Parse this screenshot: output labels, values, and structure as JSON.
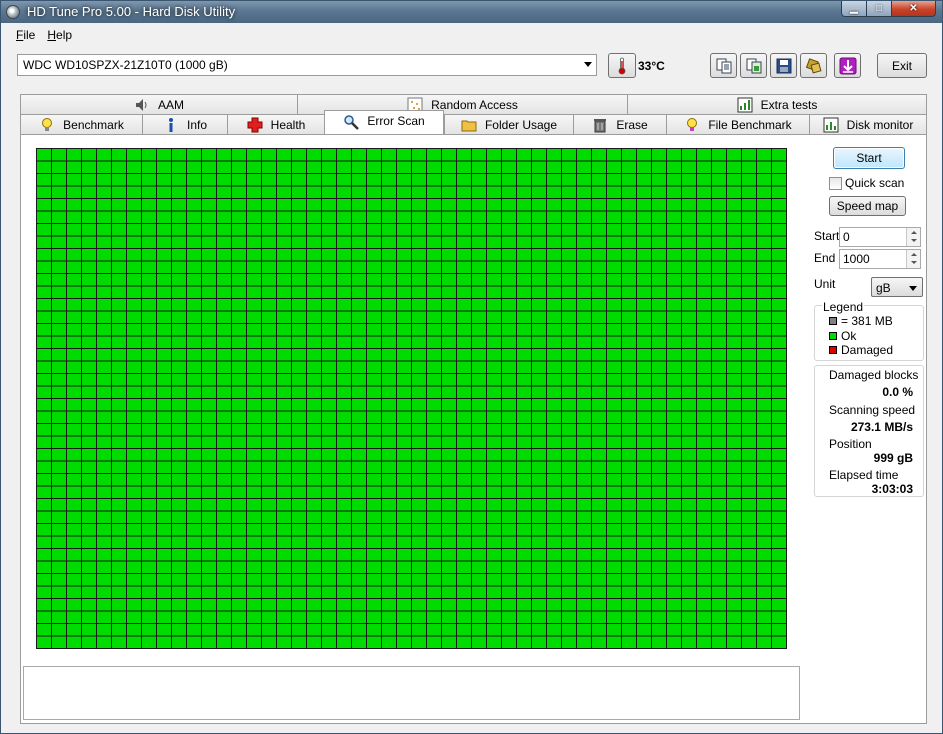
{
  "window": {
    "title": "HD Tune Pro 5.00 - Hard Disk Utility"
  },
  "menu": {
    "file": "File",
    "help": "Help"
  },
  "toolbar": {
    "drive": "WDC WD10SPZX-21Z10T0 (1000 gB)",
    "temperature": "33°C",
    "exit_label": "Exit",
    "icons": [
      "copy-text-icon",
      "copy-screenshot-icon",
      "save-icon",
      "options-icon",
      "download-icon"
    ]
  },
  "tabs_top": [
    {
      "label": "AAM",
      "icon": "speaker-icon"
    },
    {
      "label": "Random Access",
      "icon": "random-access-icon"
    },
    {
      "label": "Extra tests",
      "icon": "extra-tests-icon"
    }
  ],
  "tabs_bottom": [
    {
      "label": "Benchmark",
      "icon": "lightbulb-icon"
    },
    {
      "label": "Info",
      "icon": "info-icon"
    },
    {
      "label": "Health",
      "icon": "health-cross-icon"
    },
    {
      "label": "Error Scan",
      "icon": "magnifier-icon",
      "active": true
    },
    {
      "label": "Folder Usage",
      "icon": "folder-icon"
    },
    {
      "label": "Erase",
      "icon": "trash-icon"
    },
    {
      "label": "File Benchmark",
      "icon": "file-benchmark-icon"
    },
    {
      "label": "Disk monitor",
      "icon": "disk-monitor-icon"
    }
  ],
  "scan": {
    "start_label": "Start",
    "quick_scan_label": "Quick scan",
    "quick_scan_checked": false,
    "speed_map_label": "Speed map",
    "start_field_label": "Start",
    "start_value": "0",
    "end_field_label": "End",
    "end_value": "1000",
    "unit_label": "Unit",
    "unit_value": "gB",
    "block_color": "#00dc00"
  },
  "legend": {
    "title": "Legend",
    "items": [
      {
        "label": "= 381 MB",
        "color": "#808080"
      },
      {
        "label": "Ok",
        "color": "#00dc00"
      },
      {
        "label": "Damaged",
        "color": "#e00000"
      }
    ]
  },
  "stats": {
    "damaged_label": "Damaged blocks",
    "damaged_value": "0.0 %",
    "speed_label": "Scanning speed",
    "speed_value": "273.1 MB/s",
    "position_label": "Position",
    "position_value": "999 gB",
    "elapsed_label": "Elapsed time",
    "elapsed_value": "3:03:03"
  }
}
